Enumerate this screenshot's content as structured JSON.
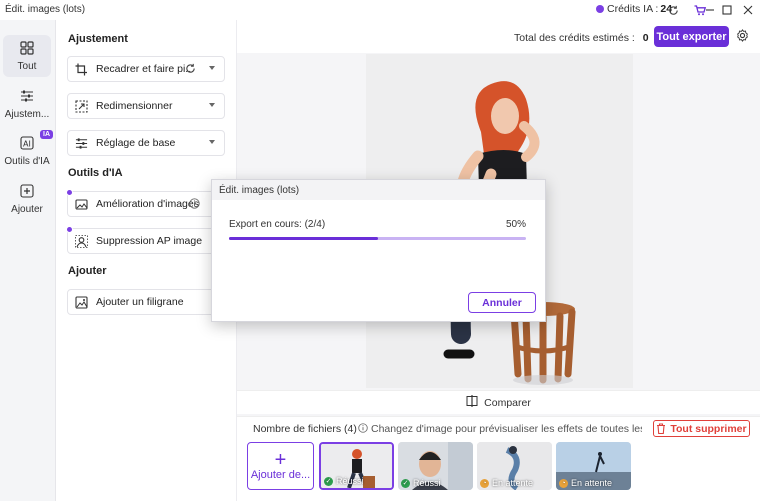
{
  "window": {
    "title": "Édit. images (lots)"
  },
  "credits": {
    "label": "Crédits IA :",
    "value": "24",
    "accent": "#7b3fe4"
  },
  "rail": {
    "items": [
      {
        "label": "Tout",
        "icon": "grid-icon"
      },
      {
        "label": "Ajustem...",
        "icon": "sliders-icon"
      },
      {
        "label": "Outils d'IA",
        "icon": "ai-icon",
        "badge": "IA"
      },
      {
        "label": "Ajouter",
        "icon": "plus-square-icon"
      }
    ]
  },
  "panel": {
    "section_adjust": "Ajustement",
    "tools_adjust": [
      {
        "label": "Recadrer et faire pi...",
        "icon": "crop-icon"
      },
      {
        "label": "Redimensionner",
        "icon": "resize-icon"
      },
      {
        "label": "Réglage de base",
        "icon": "sliders-icon"
      }
    ],
    "section_ai": "Outils d'IA",
    "tools_ai": [
      {
        "label": "Amélioration d'images",
        "icon": "enhance-icon"
      },
      {
        "label": "Suppression AP image",
        "icon": "bg-remove-icon"
      }
    ],
    "section_add": "Ajouter",
    "tools_add": [
      {
        "label": "Ajouter un filigrane",
        "icon": "watermark-icon"
      }
    ]
  },
  "toolbar": {
    "estimate_label": "Total des crédits estimés :",
    "estimate_value": "0",
    "export_label": "Tout exporter"
  },
  "compare": {
    "label": "Comparer"
  },
  "files": {
    "count_label": "Nombre de fichiers (4)",
    "hint": "Changez d'image pour prévisualiser les effets de toutes les fonctio...",
    "delete_all": "Tout supprimer",
    "add_label": "Ajouter de...",
    "thumbnails": [
      {
        "status": "Réussi",
        "state": "success"
      },
      {
        "status": "Réussi",
        "state": "success"
      },
      {
        "status": "En attente",
        "state": "pending"
      },
      {
        "status": "En attente",
        "state": "pending"
      }
    ]
  },
  "dialog": {
    "title": "Édit. images (lots)",
    "status": "Export en cours: (2/4)",
    "percent_label": "50%",
    "progress": 0.5,
    "cancel": "Annuler"
  },
  "colors": {
    "accent": "#6a2fd8",
    "danger": "#e0403a",
    "success": "#2e9e4f",
    "pending": "#e8a23a"
  }
}
